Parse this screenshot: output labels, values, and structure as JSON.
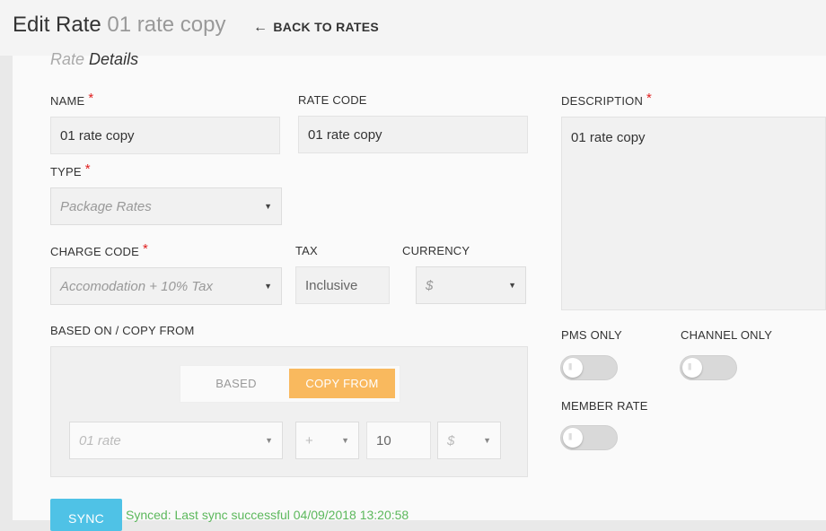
{
  "header": {
    "title": "Edit Rate",
    "subtitle": "01 rate copy",
    "back_label": "BACK TO RATES"
  },
  "section": {
    "title_faded": "Rate",
    "title": "Details"
  },
  "form": {
    "name_label": "NAME",
    "name_value": "01 rate copy",
    "rate_code_label": "RATE CODE",
    "rate_code_value": "01 rate copy",
    "description_label": "DESCRIPTION",
    "description_value": "01 rate copy",
    "type_label": "TYPE",
    "type_value": "Package Rates",
    "charge_code_label": "CHARGE CODE",
    "charge_code_value": "Accomodation + 10% Tax",
    "tax_label": "TAX",
    "tax_value": "Inclusive",
    "currency_label": "CURRENCY",
    "currency_value": "$",
    "required_marker": "*"
  },
  "based_on": {
    "label": "BASED ON / COPY FROM",
    "tab_based": "BASED",
    "tab_copy_from": "COPY FROM",
    "active_tab": "COPY FROM",
    "rate_value": "01 rate",
    "operator_value": "+",
    "amount_value": "10",
    "unit_value": "$"
  },
  "toggles": {
    "pms_only_label": "PMS ONLY",
    "pms_only": false,
    "channel_only_label": "CHANNEL ONLY",
    "channel_only": false,
    "member_rate_label": "MEMBER RATE",
    "member_rate": false
  },
  "sync": {
    "button_label": "SYNC",
    "status": "Synced: Last sync successful 04/09/2018 13:20:58"
  },
  "colors": {
    "accent_orange": "#f9b95e",
    "sync_blue": "#4fc2e6",
    "success_green": "#5cb85c",
    "required_red": "#e02020"
  }
}
